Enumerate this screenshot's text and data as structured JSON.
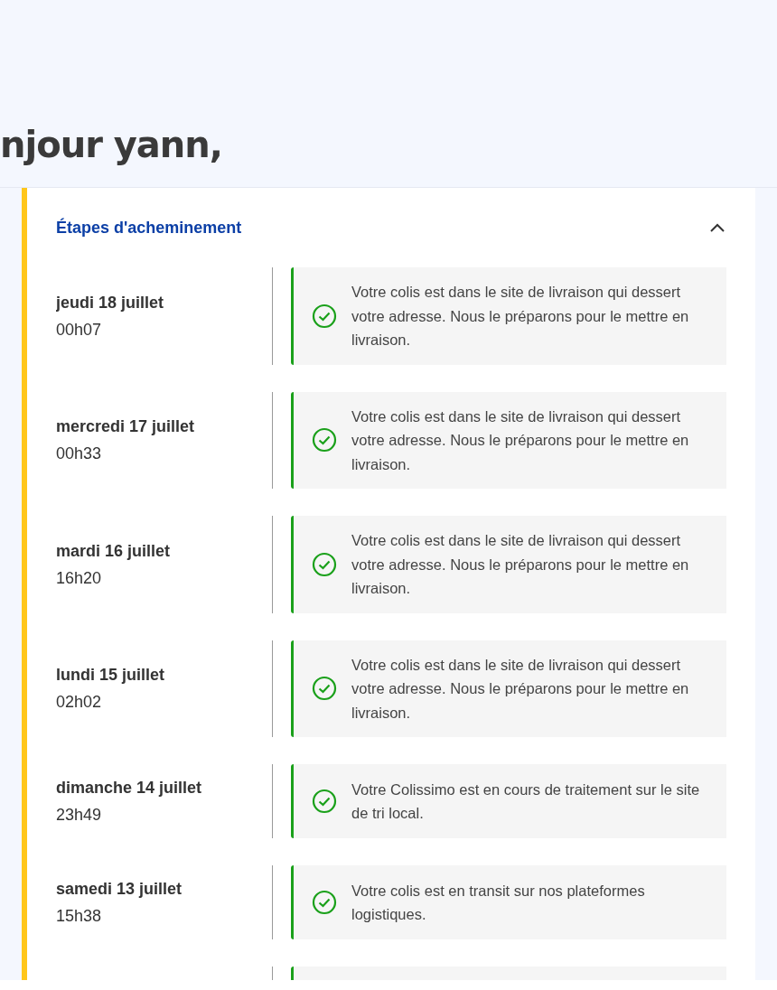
{
  "greeting": "njour yann,",
  "section": {
    "title": "Étapes d'acheminement",
    "expanded": true
  },
  "events": [
    {
      "date": "jeudi 18 juillet",
      "time": "00h07",
      "message": "Votre colis est dans le site de livraison qui dessert votre adresse. Nous le préparons pour le mettre en livraison.",
      "done": true
    },
    {
      "date": "mercredi 17 juillet",
      "time": "00h33",
      "message": "Votre colis est dans le site de livraison qui dessert votre adresse. Nous le préparons pour le mettre en livraison.",
      "done": true
    },
    {
      "date": "mardi 16 juillet",
      "time": "16h20",
      "message": "Votre colis est dans le site de livraison qui dessert votre adresse. Nous le préparons pour le mettre en livraison.",
      "done": true
    },
    {
      "date": "lundi 15 juillet",
      "time": "02h02",
      "message": "Votre colis est dans le site de livraison qui dessert votre adresse. Nous le préparons pour le mettre en livraison.",
      "done": true
    },
    {
      "date": "dimanche 14 juillet",
      "time": "23h49",
      "message": "Votre Colissimo est en cours de traitement sur le site de tri local.",
      "done": true
    },
    {
      "date": "samedi 13 juillet",
      "time": "15h38",
      "message": "Votre colis est en transit sur nos plateformes logistiques.",
      "done": true
    }
  ]
}
